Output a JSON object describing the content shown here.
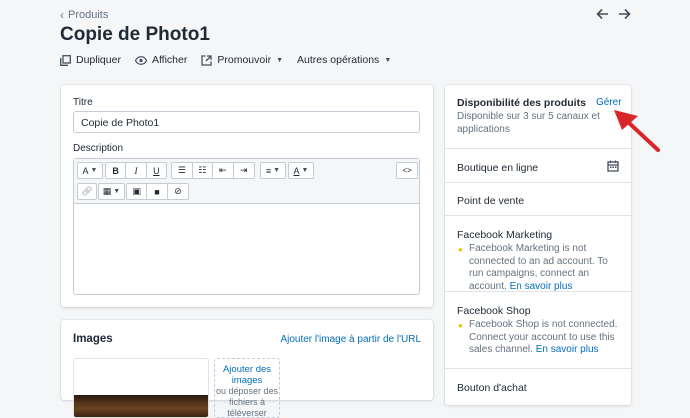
{
  "breadcrumb": {
    "label": "Produits"
  },
  "title": "Copie de Photo1",
  "actions": {
    "duplicate": "Dupliquer",
    "view": "Afficher",
    "promote": "Promouvoir",
    "more": "Autres opérations"
  },
  "form": {
    "title_label": "Titre",
    "title_value": "Copie de Photo1",
    "description_label": "Description"
  },
  "images": {
    "heading": "Images",
    "add_from_url": "Ajouter l'image à partir de l'URL",
    "add_images": "Ajouter des images",
    "or_drop": "ou déposer des fichiers à téléverser"
  },
  "availability": {
    "heading": "Disponibilité des produits",
    "manage": "Gérer",
    "subtitle": "Disponible sur 3 sur 5 canaux et applications",
    "channels": [
      {
        "name": "Boutique en ligne"
      },
      {
        "name": "Point de vente"
      },
      {
        "name": "Facebook Marketing",
        "note": "Facebook Marketing is not connected to an ad account. To run campaigns, connect an account.",
        "link": "En savoir plus"
      },
      {
        "name": "Facebook Shop",
        "note": "Facebook Shop is not connected. Connect your account to use this sales channel.",
        "link": "En savoir plus"
      },
      {
        "name": "Bouton d'achat"
      }
    ]
  },
  "colors": {
    "link": "#006fbb",
    "background": "#f4f6f8",
    "arrow": "#d8262b",
    "warning_dot": "#eec200"
  }
}
